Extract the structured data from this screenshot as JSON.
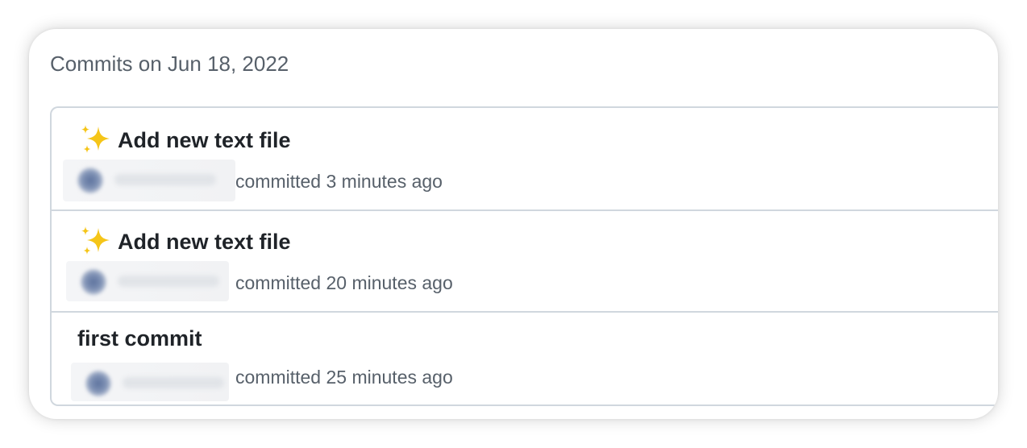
{
  "commit_group": {
    "heading": "Commits on Jun 18, 2022"
  },
  "commits": [
    {
      "icon": "sparkles-icon",
      "message": "Add new text file",
      "meta": "committed 3 minutes ago"
    },
    {
      "icon": "sparkles-icon",
      "message": "Add new text file",
      "meta": "committed 20 minutes ago"
    },
    {
      "message": "first commit",
      "meta": "committed 25 minutes ago"
    }
  ],
  "colors": {
    "heading_text": "#57606a",
    "title_text": "#1f2328",
    "border": "#d0d7de",
    "sparkle": "#f5c518"
  }
}
